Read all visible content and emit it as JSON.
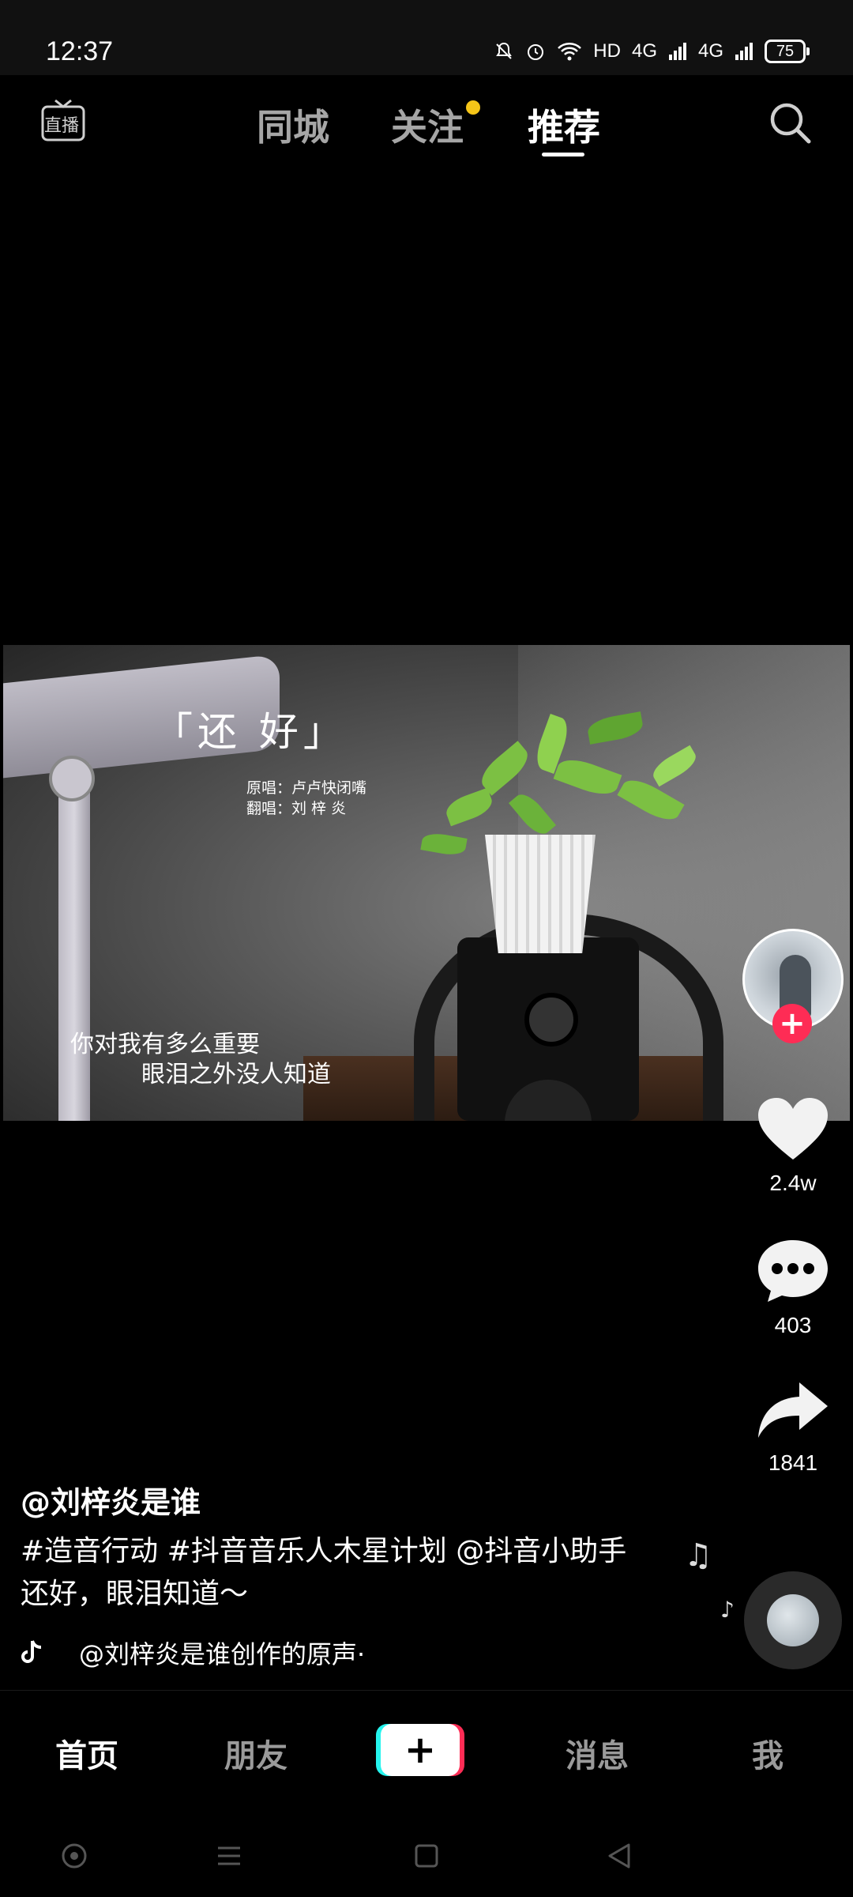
{
  "status_bar": {
    "time": "12:37",
    "network": "HD",
    "signal1": "4G",
    "signal2": "4G",
    "battery": "75"
  },
  "top_nav": {
    "live_icon_label": "直播",
    "tabs": [
      {
        "label": "同城",
        "active": false
      },
      {
        "label": "关注",
        "active": false,
        "has_dot": true
      },
      {
        "label": "推荐",
        "active": true
      }
    ]
  },
  "video": {
    "title": "「还 好」",
    "credit_original": "原唱：卢卢快闭嘴",
    "credit_cover": "翻唱：刘  梓  炎",
    "lyric_line1": "你对我有多么重要",
    "lyric_line2": "眼泪之外没人知道"
  },
  "right_rail": {
    "like_count": "2.4w",
    "comment_count": "403",
    "share_count": "1841"
  },
  "caption": {
    "author": "@刘梓炎是谁",
    "description_line1": "#造音行动 #抖音音乐人木星计划 @抖音小助手",
    "description_line2": "还好，眼泪知道～",
    "music": "@刘梓炎是谁创作的原声·"
  },
  "bottom_tabs": {
    "home": "首页",
    "friends": "朋友",
    "messages": "消息",
    "me": "我"
  },
  "colors": {
    "accent_red": "#fe2c55",
    "accent_cyan": "#25f4ee",
    "follow_dot": "#f5c518"
  }
}
